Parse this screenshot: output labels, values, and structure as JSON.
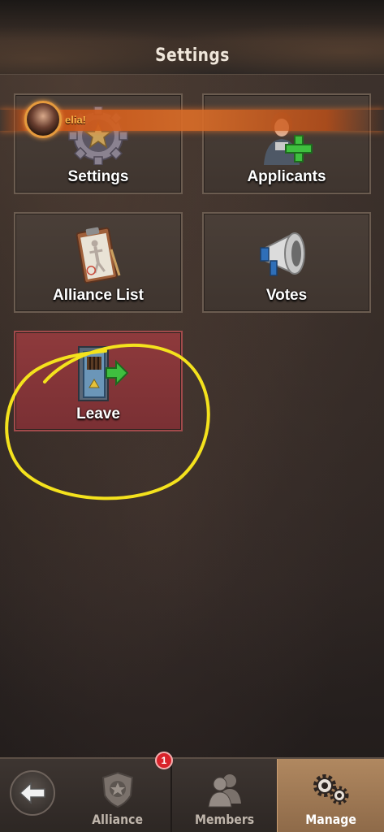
{
  "header": {
    "title": "Settings"
  },
  "notification": {
    "text": "elia!"
  },
  "tiles": [
    {
      "label": "Settings",
      "icon": "gear-star-icon"
    },
    {
      "label": "Applicants",
      "icon": "add-member-icon"
    },
    {
      "label": "Alliance List",
      "icon": "clipboard-icon"
    },
    {
      "label": "Votes",
      "icon": "megaphone-icon"
    },
    {
      "label": "Leave",
      "icon": "exit-door-icon"
    }
  ],
  "nav": {
    "back_icon": "back-arrow-icon",
    "tabs": [
      {
        "label": "Alliance",
        "icon": "shield-star-icon",
        "badge": "1"
      },
      {
        "label": "Members",
        "icon": "people-icon"
      },
      {
        "label": "Manage",
        "icon": "gears-icon",
        "active": true
      }
    ]
  },
  "colors": {
    "danger_tile": "#7a3034",
    "accent": "#b08860",
    "annotation": "#f4e21d",
    "badge": "#d9232b"
  }
}
